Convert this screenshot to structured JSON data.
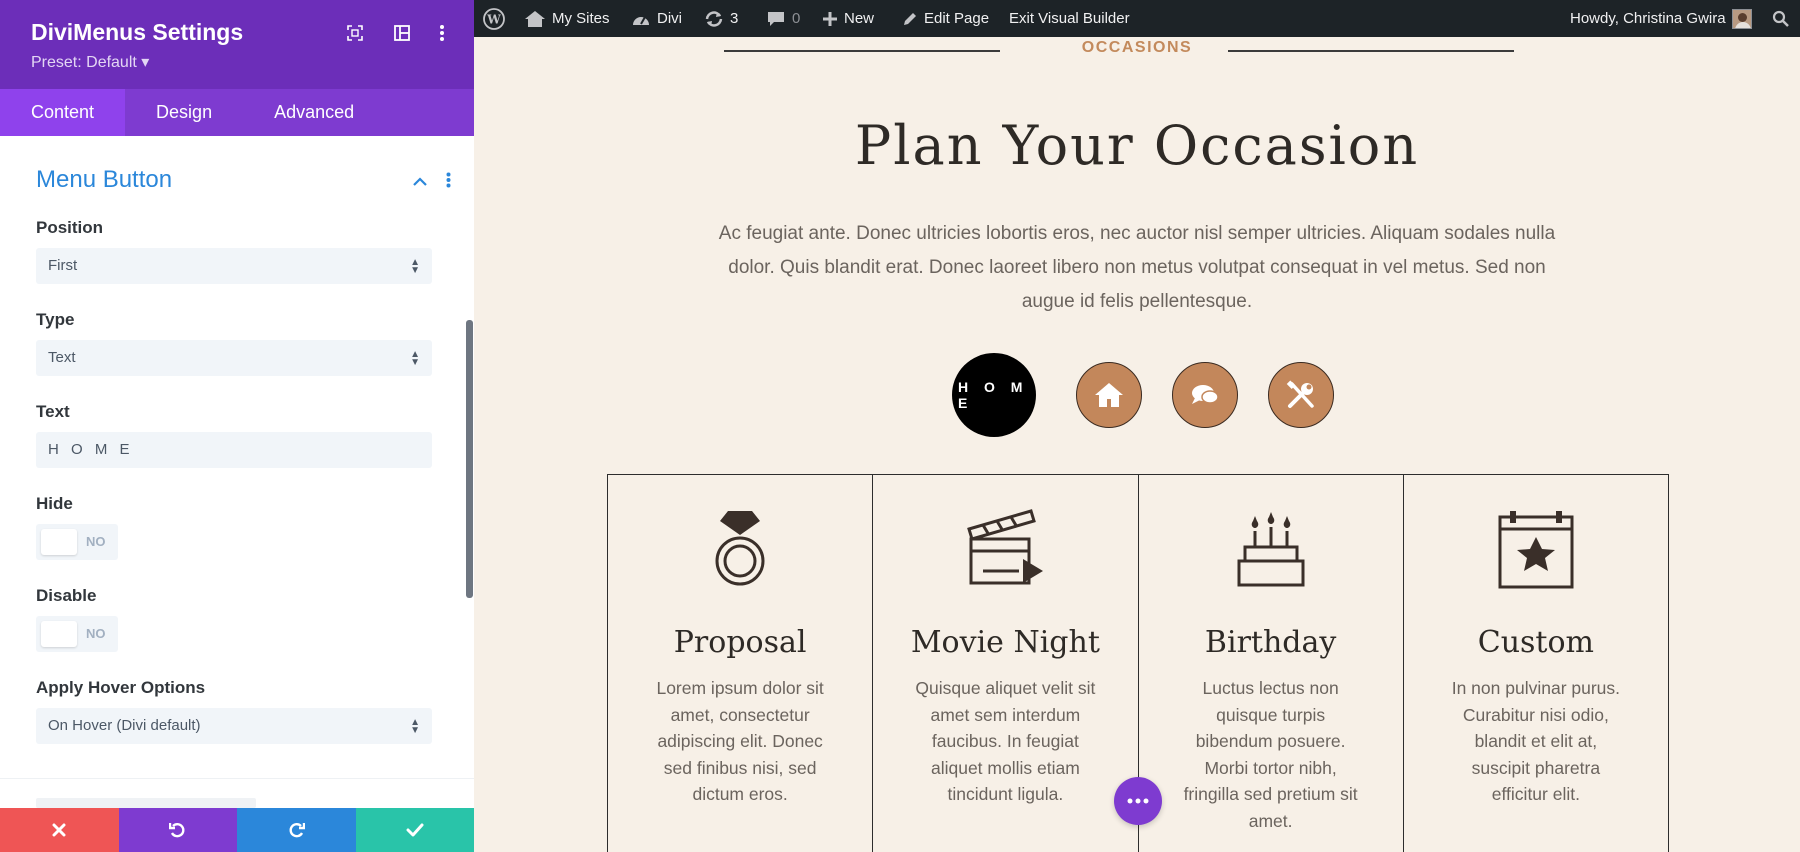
{
  "panel": {
    "title": "DiviMenus Settings",
    "preset": "Preset: Default ▾",
    "tabs": [
      {
        "label": "Content"
      },
      {
        "label": "Design"
      },
      {
        "label": "Advanced"
      }
    ],
    "section_title": "Menu Button",
    "fields": {
      "position": {
        "label": "Position",
        "value": "First"
      },
      "type": {
        "label": "Type",
        "value": "Text"
      },
      "text": {
        "label": "Text",
        "value": "H O M E"
      },
      "hide": {
        "label": "Hide",
        "state": "NO"
      },
      "disable": {
        "label": "Disable",
        "state": "NO"
      },
      "hover": {
        "label": "Apply Hover Options",
        "value": "On Hover (Divi default)"
      }
    },
    "colors": {
      "header": "#6c2eb9",
      "tabs": "#7e3bd0",
      "active_tab": "#8f42ec",
      "section_title": "#2b87da",
      "cancel": "#ef5555",
      "undo": "#7e3bd0",
      "redo": "#2b87da",
      "save": "#29c4a9"
    }
  },
  "admin_bar": {
    "my_sites": "My Sites",
    "divi": "Divi",
    "updates_count": "3",
    "comments_count": "0",
    "new": "New",
    "edit_page": "Edit Page",
    "exit_builder": "Exit Visual Builder",
    "howdy": "Howdy, Christina Gwira"
  },
  "page": {
    "eyebrow": "OCCASIONS",
    "heading": "Plan Your Occasion",
    "intro": "Ac feugiat ante. Donec ultricies lobortis eros, nec auctor nisl semper ultricies. Aliquam sodales nulla dolor. Quis blandit erat. Donec laoreet libero non metus volutpat consequat in vel metus. Sed non augue id felis pellentesque.",
    "menu": {
      "home_label": "H O M E",
      "icons": [
        "home-icon",
        "chat-icon",
        "tools-icon"
      ]
    },
    "cards": [
      {
        "title": "Proposal",
        "text": "Lorem ipsum dolor sit amet, consectetur adipiscing elit. Donec sed finibus nisi, sed dictum eros.",
        "icon": "ring-icon"
      },
      {
        "title": "Movie Night",
        "text": "Quisque aliquet velit sit amet sem interdum faucibus. In feugiat aliquet mollis etiam tincidunt ligula.",
        "icon": "clapperboard-icon"
      },
      {
        "title": "Birthday",
        "text": "Luctus lectus non quisque turpis bibendum posuere. Morbi tortor nibh, fringilla sed pretium sit amet.",
        "icon": "cake-icon"
      },
      {
        "title": "Custom",
        "text": "In non pulvinar purus. Curabitur nisi odio, blandit et elit at, suscipit pharetra efficitur elit.",
        "icon": "calendar-star-icon"
      }
    ],
    "accent": "#c3875b"
  }
}
